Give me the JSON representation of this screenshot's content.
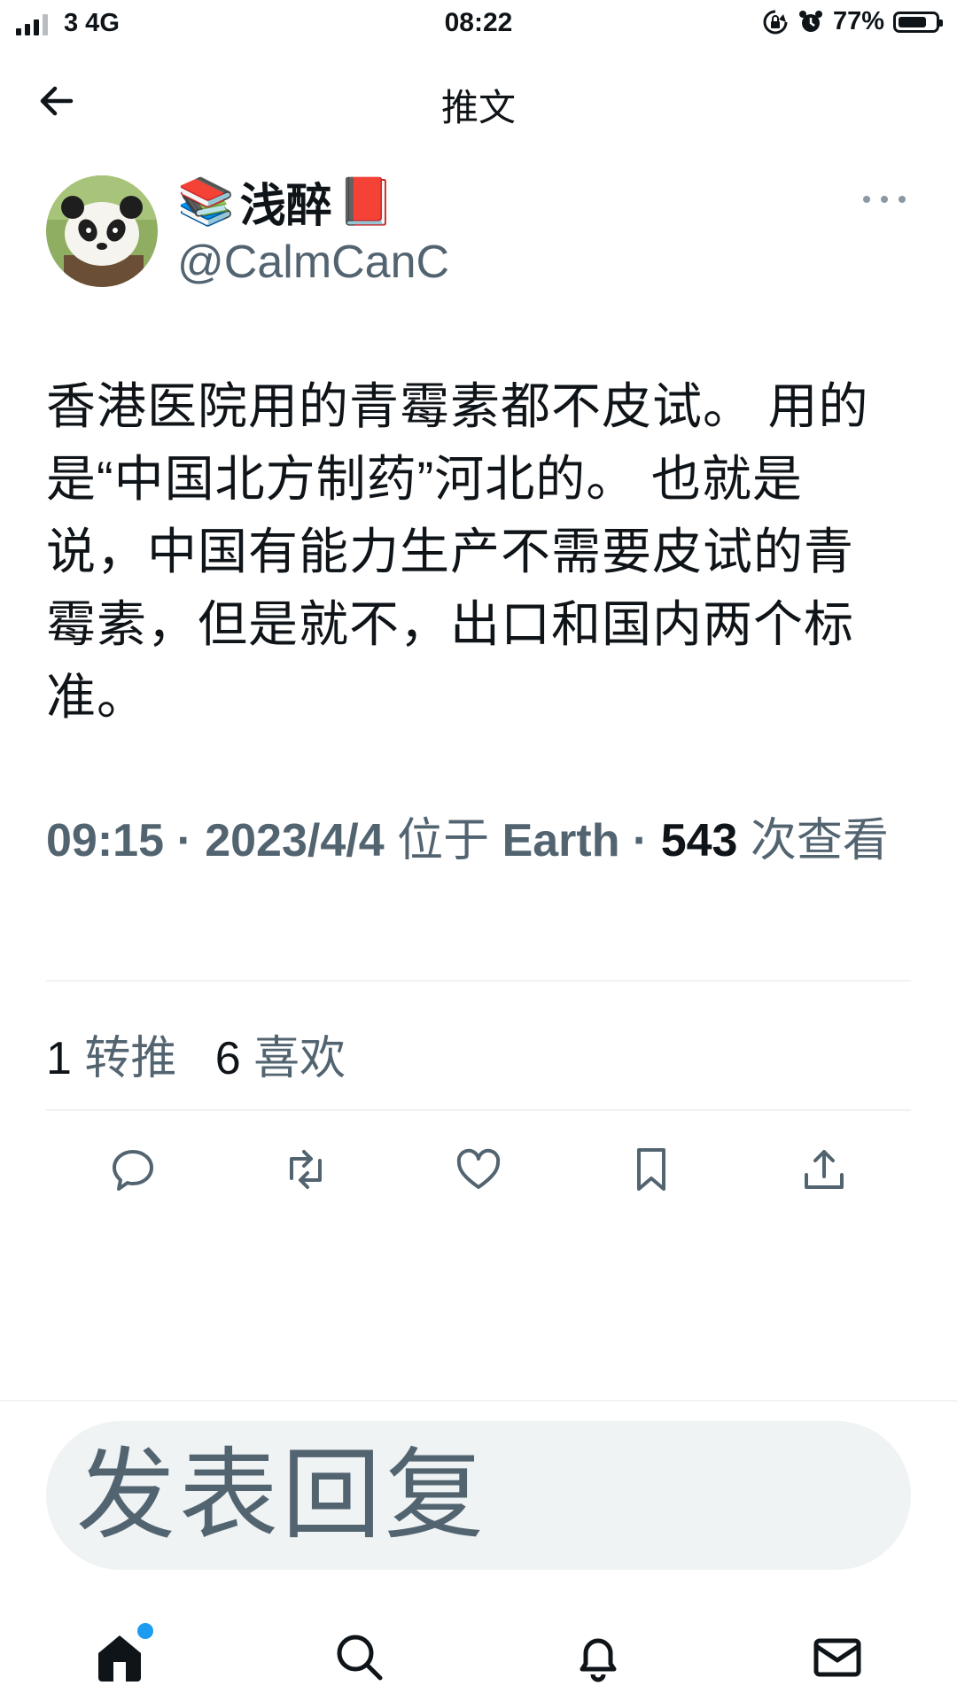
{
  "status_bar": {
    "carrier": "3  4G",
    "time": "08:22",
    "battery_percent": "77%",
    "battery_level": 0.77,
    "icons": [
      "signal-icon",
      "rotation-lock-icon",
      "alarm-icon",
      "battery-icon"
    ]
  },
  "header": {
    "title": "推文",
    "back_icon": "arrow-left-icon"
  },
  "tweet": {
    "author": {
      "display_name": "浅醉",
      "name_prefix_emoji": "📚",
      "name_suffix_emoji": "📕",
      "handle": "@CalmCanC"
    },
    "text": "香港医院用的青霉素都不皮试。 用的是“中国北方制药”河北的。 也就是说，中国有能力生产不需要皮试的青霉素，但是就不，出口和国内两个标准。",
    "meta": {
      "time": "09:15",
      "separator": " · ",
      "date": "2023/4/4",
      "location_prefix": "位于",
      "location": "Earth",
      "views": "543",
      "views_label": "次查看"
    },
    "stats": {
      "retweets": "1",
      "retweets_label": "转推",
      "likes": "6",
      "likes_label": "喜欢"
    }
  },
  "actions": [
    "reply-icon",
    "retweet-icon",
    "like-icon",
    "bookmark-icon",
    "share-icon"
  ],
  "reply_box": {
    "placeholder": "发表回复"
  },
  "tab_bar": [
    "home-icon",
    "search-icon",
    "notifications-icon",
    "messages-icon"
  ],
  "colors": {
    "text_primary": "#0f1419",
    "text_secondary": "#536471",
    "divider": "#eff3f4",
    "accent": "#1d9bf0"
  }
}
